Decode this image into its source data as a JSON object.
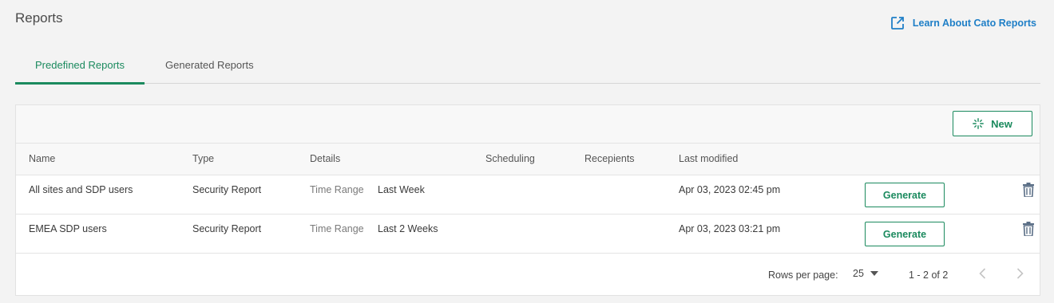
{
  "header": {
    "title": "Reports",
    "learn_link": "Learn About Cato Reports",
    "learn_icon": "external-link-icon",
    "accent_color": "#1b8a5e",
    "link_color": "#1f7fc7"
  },
  "tabs": [
    {
      "label": "Predefined Reports",
      "active": true
    },
    {
      "label": "Generated Reports",
      "active": false
    }
  ],
  "toolbar": {
    "new_label": "New",
    "new_icon": "sparkle-icon"
  },
  "table": {
    "columns": [
      "Name",
      "Type",
      "Details",
      "Scheduling",
      "Recepients",
      "Last modified"
    ],
    "rows": [
      {
        "name": "All sites and SDP users",
        "type": "Security Report",
        "details_key": "Time Range",
        "details_value": "Last Week",
        "scheduling": "",
        "recipients": "",
        "last_modified": "Apr 03, 2023 02:45 pm",
        "action_label": "Generate",
        "delete_icon": "trash-icon"
      },
      {
        "name": "EMEA SDP users",
        "type": "Security Report",
        "details_key": "Time Range",
        "details_value": "Last 2 Weeks",
        "scheduling": "",
        "recipients": "",
        "last_modified": "Apr 03, 2023 03:21 pm",
        "action_label": "Generate",
        "delete_icon": "trash-icon"
      }
    ]
  },
  "pagination": {
    "rows_per_page_label": "Rows per page:",
    "rows_per_page_value": "25",
    "range_text": "1 - 2 of 2",
    "prev_icon": "chevron-left-icon",
    "next_icon": "chevron-right-icon"
  }
}
